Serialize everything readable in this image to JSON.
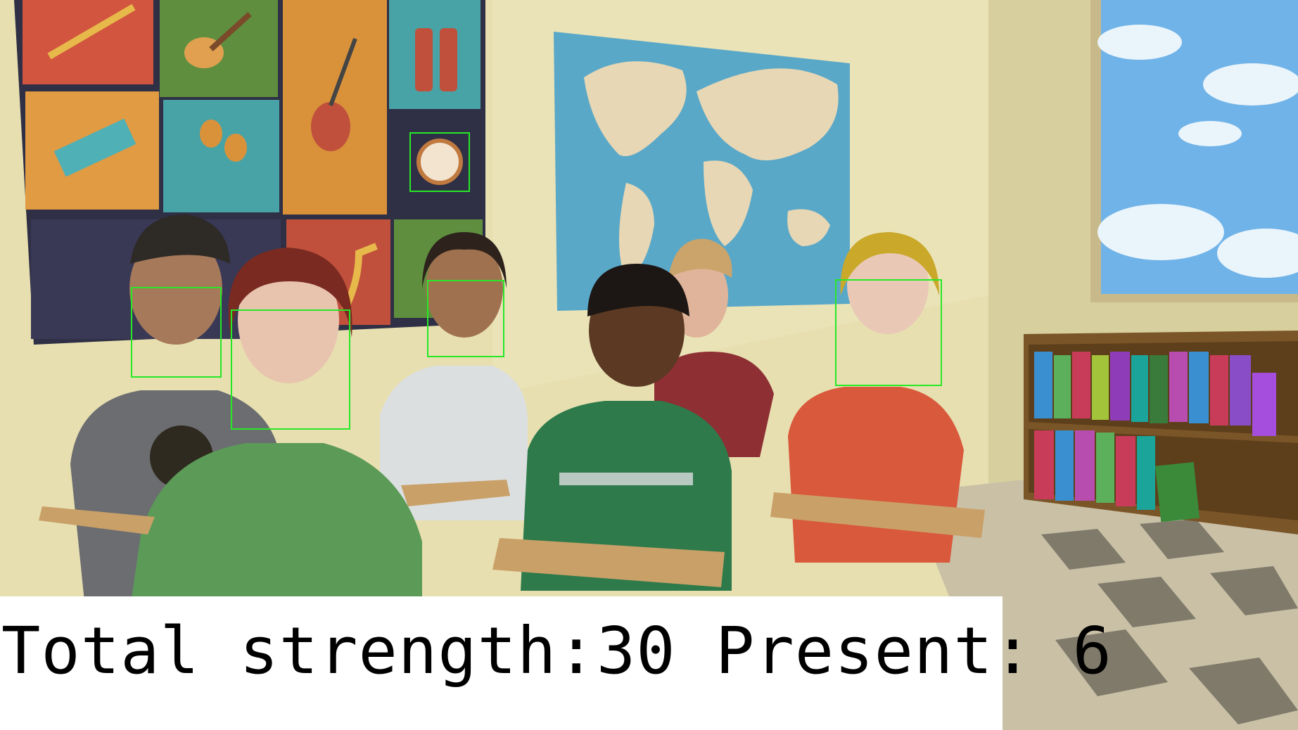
{
  "overlay": {
    "total_label": "Total strength:",
    "total_value": "30",
    "present_label": " Present: ",
    "present_value": "6"
  },
  "detection_box_color": "#27e827",
  "detections": [
    {
      "name": "face-detection-box-boy-left"
    },
    {
      "name": "face-detection-box-girl-front"
    },
    {
      "name": "face-detection-box-girl-middle"
    },
    {
      "name": "face-detection-box-girl-right"
    },
    {
      "name": "face-detection-box-tambourine"
    }
  ],
  "colors": {
    "wall": "#e7dfb0",
    "floor_light": "#c9c0a6",
    "floor_dark": "#7f7a6a",
    "map_ocean": "#5aa8c8",
    "sky": "#6fb3e8"
  }
}
